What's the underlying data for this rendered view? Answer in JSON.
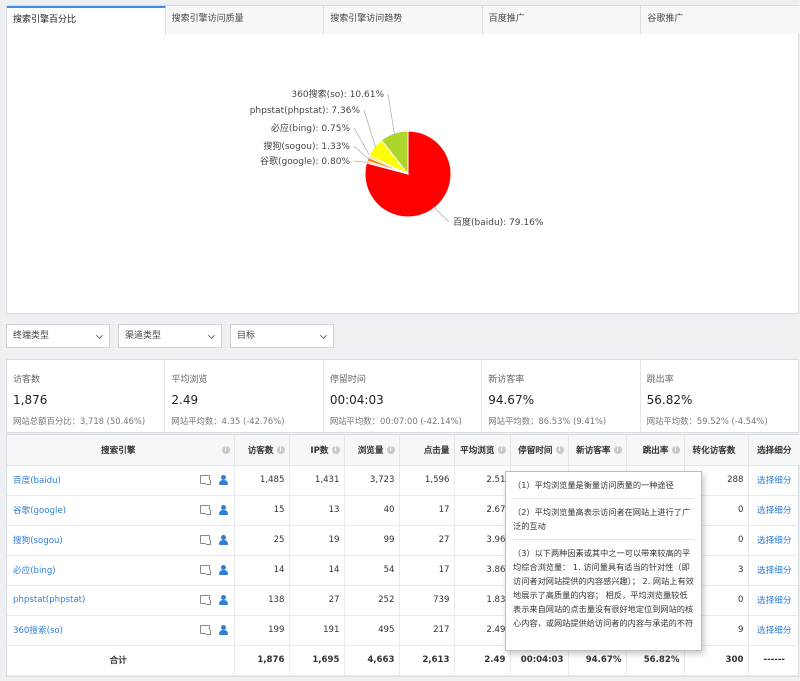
{
  "tabs": [
    {
      "label": "搜索引擎百分比",
      "active": true
    },
    {
      "label": "搜索引擎访问质量",
      "active": false
    },
    {
      "label": "搜索引擎访问趋势",
      "active": false
    },
    {
      "label": "百度推广",
      "active": false
    },
    {
      "label": "谷歌推广",
      "active": false
    }
  ],
  "chart_data": {
    "type": "pie",
    "slices": [
      {
        "label": "百度(baidu): 79.16%",
        "value": 79.16,
        "color": "#ff0000"
      },
      {
        "label": "谷歌(google): 0.80%",
        "value": 0.8,
        "color": "#ffc6a5"
      },
      {
        "label": "搜狗(sogou): 1.33%",
        "value": 1.33,
        "color": "#ff7f00"
      },
      {
        "label": "必应(bing): 0.75%",
        "value": 0.75,
        "color": "#ffd700"
      },
      {
        "label": "phpstat(phpstat): 7.36%",
        "value": 7.36,
        "color": "#ffff00"
      },
      {
        "label": "360搜索(so): 10.61%",
        "value": 10.61,
        "color": "#acd62c"
      }
    ]
  },
  "filters": [
    "终端类型",
    "渠道类型",
    "目标"
  ],
  "stats": [
    {
      "label": "访客数",
      "value": "1,876",
      "sub": "网站总额百分比：3,718 (50.46%)"
    },
    {
      "label": "平均浏览",
      "value": "2.49",
      "sub": "网站平均数：4.35 (-42.76%)"
    },
    {
      "label": "停留时间",
      "value": "00:04:03",
      "sub": "网站平均数：00:07:00 (-42.14%)"
    },
    {
      "label": "新访客率",
      "value": "94.67%",
      "sub": "网站平均数：86.53% (9.41%)"
    },
    {
      "label": "跳出率",
      "value": "56.82%",
      "sub": "网站平均数：59.52% (-4.54%)"
    }
  ],
  "table": {
    "headers": [
      "搜索引擎",
      "访客数",
      "IP数",
      "浏览量",
      "点击量",
      "平均浏览",
      "停留时间",
      "新访客率",
      "跳出率",
      "转化访客数",
      "选择细分"
    ],
    "rows": [
      {
        "engine": "百度(baidu)",
        "visitors": "1,485",
        "ip": "1,431",
        "pv": "3,723",
        "clicks": "1,596",
        "avg": "2.51",
        "time": "",
        "new": "",
        "bounce": "",
        "conv": "288",
        "detail": "选择细分"
      },
      {
        "engine": "谷歌(google)",
        "visitors": "15",
        "ip": "13",
        "pv": "40",
        "clicks": "17",
        "avg": "2.67",
        "time": "",
        "new": "",
        "bounce": "",
        "conv": "0",
        "detail": "选择细分"
      },
      {
        "engine": "搜狗(sogou)",
        "visitors": "25",
        "ip": "19",
        "pv": "99",
        "clicks": "27",
        "avg": "3.96",
        "time": "",
        "new": "",
        "bounce": "",
        "conv": "0",
        "detail": "选择细分"
      },
      {
        "engine": "必应(bing)",
        "visitors": "14",
        "ip": "14",
        "pv": "54",
        "clicks": "17",
        "avg": "3.86",
        "time": "",
        "new": "",
        "bounce": "",
        "conv": "3",
        "detail": "选择细分"
      },
      {
        "engine": "phpstat(phpstat)",
        "visitors": "138",
        "ip": "27",
        "pv": "252",
        "clicks": "739",
        "avg": "1.83",
        "time": "",
        "new": "",
        "bounce": "",
        "conv": "0",
        "detail": "选择细分"
      },
      {
        "engine": "360搜索(so)",
        "visitors": "199",
        "ip": "191",
        "pv": "495",
        "clicks": "217",
        "avg": "2.49",
        "time": "",
        "new": "",
        "bounce": "",
        "conv": "9",
        "detail": "选择细分"
      }
    ],
    "total": {
      "label": "合计",
      "visitors": "1,876",
      "ip": "1,695",
      "pv": "4,663",
      "clicks": "2,613",
      "avg": "2.49",
      "time": "00:04:03",
      "new": "94.67%",
      "bounce": "56.82%",
      "conv": "300",
      "detail": "------"
    }
  },
  "tooltip": {
    "p1": "（1）平均浏览量是衡量访问质量的一种途径",
    "p2": "（2）平均浏览量高表示访问者在网站上进行了广泛的互动",
    "p3": "（3）以下两种因素或其中之一可以带来较高的平均综合浏览量：  1. 访问量具有适当的针对性（即访问者对网站提供的内容感兴趣）；  2. 网站上有效地展示了高质量的内容；  相反，平均浏览量较低表示来自网站的点击量没有很好地定位到网站的核心内容，或网站提供给访问者的内容与承诺的不符"
  }
}
